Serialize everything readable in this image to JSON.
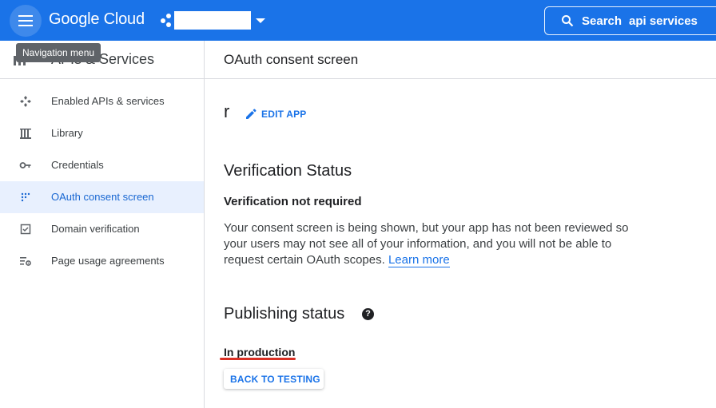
{
  "topbar": {
    "brand": "Google Cloud",
    "search_label": "Search",
    "search_query": "api services"
  },
  "tooltip": {
    "text": "Navigation menu"
  },
  "sidebar": {
    "title": "APIs & Services",
    "items": [
      {
        "label": "Enabled APIs & services",
        "icon": "api-hub-icon"
      },
      {
        "label": "Library",
        "icon": "library-icon"
      },
      {
        "label": "Credentials",
        "icon": "key-icon"
      },
      {
        "label": "OAuth consent screen",
        "icon": "consent-screen-icon",
        "active": true
      },
      {
        "label": "Domain verification",
        "icon": "checkbox-icon"
      },
      {
        "label": "Page usage agreements",
        "icon": "settings-list-icon"
      }
    ]
  },
  "main": {
    "page_title": "OAuth consent screen",
    "app_name": "r",
    "edit_label": "EDIT APP",
    "verification": {
      "heading": "Verification Status",
      "status": "Verification not required",
      "body": "Your consent screen is being shown, but your app has not been reviewed so your users may not see all of your information, and you will not be able to request certain OAuth scopes.",
      "link": "Learn more"
    },
    "publishing": {
      "heading": "Publishing status",
      "help": "?",
      "status": "In production",
      "button": "BACK TO TESTING"
    }
  },
  "colors": {
    "topbar": "#1a73e8",
    "accent": "#1a73e8",
    "active_bg": "#e8f0fe",
    "annotation_red": "#d93025"
  }
}
